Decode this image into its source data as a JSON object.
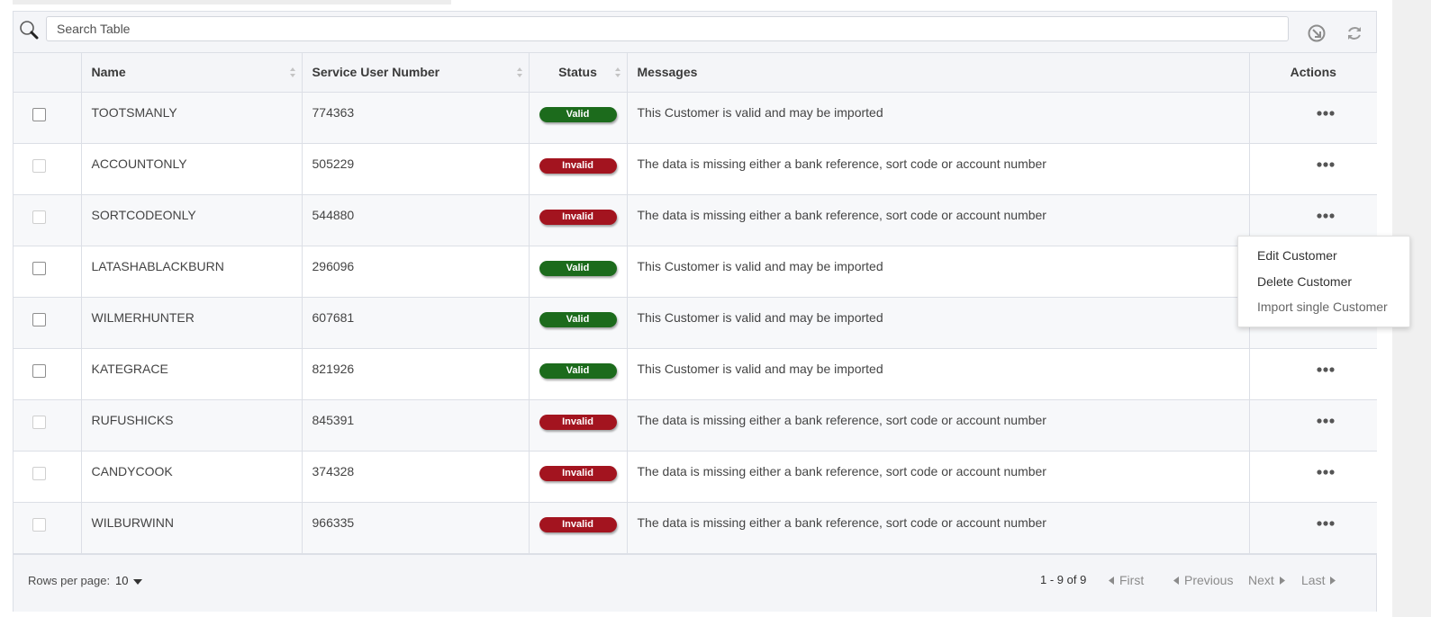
{
  "search": {
    "placeholder": "Search Table"
  },
  "columns": {
    "name": "Name",
    "service_user_number": "Service User Number",
    "status": "Status",
    "messages": "Messages",
    "actions": "Actions"
  },
  "rows": [
    {
      "name": "TOOTSMANLY",
      "sun": "774363",
      "status": "Valid",
      "message": "This Customer is valid and may be imported"
    },
    {
      "name": "ACCOUNTONLY",
      "sun": "505229",
      "status": "Invalid",
      "message": "The data is missing either a bank reference, sort code or account number"
    },
    {
      "name": "SORTCODEONLY",
      "sun": "544880",
      "status": "Invalid",
      "message": "The data is missing either a bank reference, sort code or account number"
    },
    {
      "name": "LATASHABLACKBURN",
      "sun": "296096",
      "status": "Valid",
      "message": "This Customer is valid and may be imported"
    },
    {
      "name": "WILMERHUNTER",
      "sun": "607681",
      "status": "Valid",
      "message": "This Customer is valid and may be imported"
    },
    {
      "name": "KATEGRACE",
      "sun": "821926",
      "status": "Valid",
      "message": "This Customer is valid and may be imported"
    },
    {
      "name": "RUFUSHICKS",
      "sun": "845391",
      "status": "Invalid",
      "message": "The data is missing either a bank reference, sort code or account number"
    },
    {
      "name": "CANDYCOOK",
      "sun": "374328",
      "status": "Invalid",
      "message": "The data is missing either a bank reference, sort code or account number"
    },
    {
      "name": "WILBURWINN",
      "sun": "966335",
      "status": "Invalid",
      "message": "The data is missing either a bank reference, sort code or account number"
    }
  ],
  "context_menu": {
    "items": [
      "Edit Customer",
      "Delete Customer",
      "Import single Customer"
    ]
  },
  "footer": {
    "rows_per_page_label": "Rows per page:",
    "rows_per_page_value": "10",
    "range": "1 - 9 of 9",
    "first": "First",
    "previous": "Previous",
    "next": "Next",
    "last": "Last"
  },
  "colors": {
    "valid": "#1c6b1c",
    "invalid": "#a3141f"
  },
  "icons": [
    "search-icon",
    "export-icon",
    "refresh-icon",
    "sort-icon",
    "more-dots-icon",
    "caret-down-icon",
    "caret-left-icon",
    "caret-right-icon"
  ]
}
